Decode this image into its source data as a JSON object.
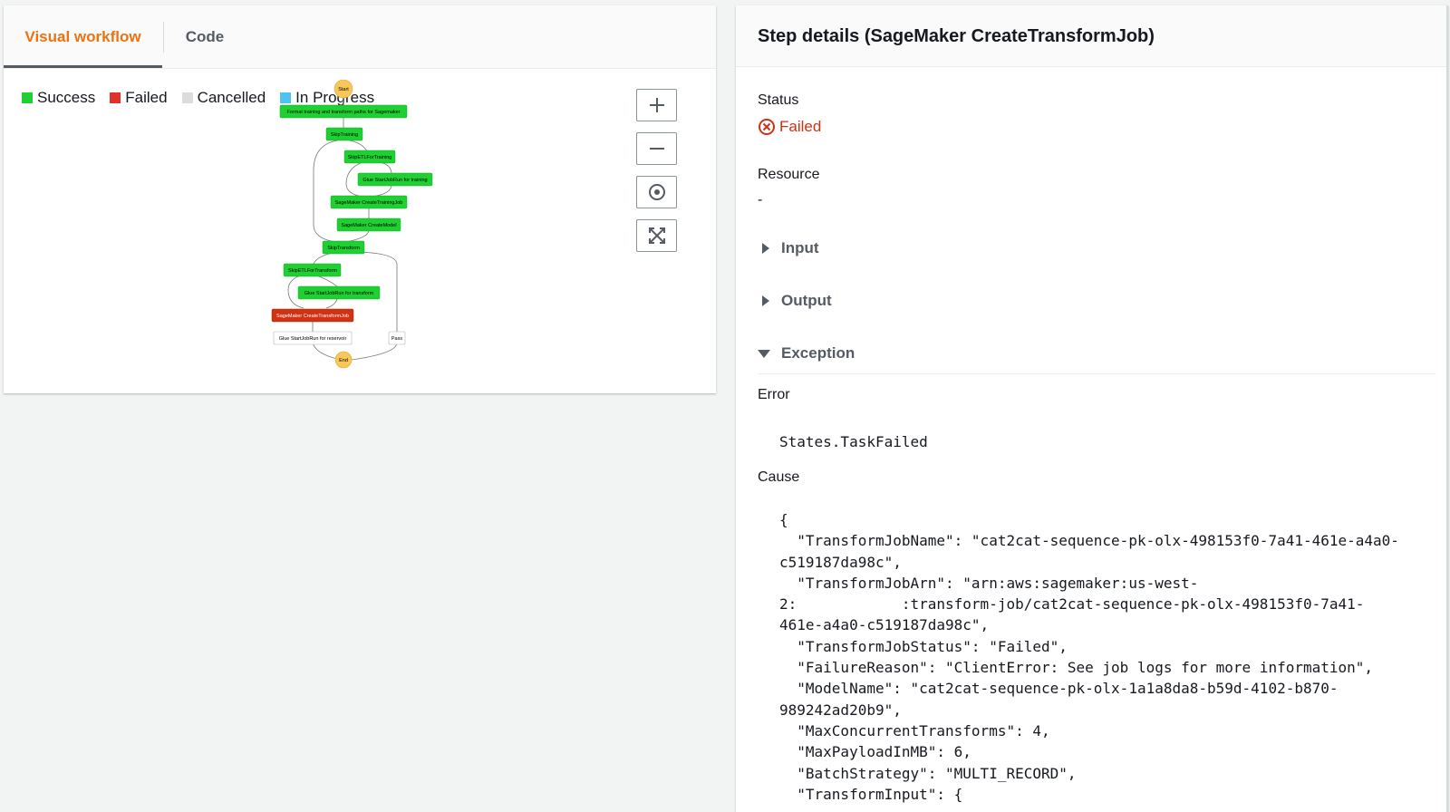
{
  "tabs": [
    {
      "label": "Visual workflow",
      "active": true
    },
    {
      "label": "Code",
      "active": false
    }
  ],
  "legend": [
    {
      "label": "Success",
      "color": "#1ed032"
    },
    {
      "label": "Failed",
      "color": "#e0312b"
    },
    {
      "label": "Cancelled",
      "color": "#dcdcdc"
    },
    {
      "label": "In Progress",
      "color": "#4ec2f0"
    }
  ],
  "zoom_controls": [
    "zoom-in-icon",
    "zoom-out-icon",
    "center-icon",
    "fit-icon"
  ],
  "graph": {
    "start": "Start",
    "end": "End",
    "nodes": [
      {
        "label": "Format training and transform paths for Sagemaker",
        "status": "success"
      },
      {
        "label": "SkipTraining",
        "status": "success"
      },
      {
        "label": "SkipETLForTraining",
        "status": "success"
      },
      {
        "label": "Glue StartJobRun for training",
        "status": "success"
      },
      {
        "label": "SageMaker CreateTrainingJob",
        "status": "success"
      },
      {
        "label": "SageMaker CreateModel",
        "status": "success"
      },
      {
        "label": "SkipTransform",
        "status": "success"
      },
      {
        "label": "SkipETLForTransform",
        "status": "success"
      },
      {
        "label": "Glue StartJobRun for transform",
        "status": "success"
      },
      {
        "label": "SageMaker CreateTransformJob",
        "status": "failed"
      },
      {
        "label": "Glue StartJobRun for reservoir",
        "status": "not-run"
      },
      {
        "label": "Pass",
        "status": "not-run"
      }
    ]
  },
  "details": {
    "title": "Step details (SageMaker CreateTransformJob)",
    "status_label": "Status",
    "status_value": "Failed",
    "resource_label": "Resource",
    "resource_value": "-",
    "input_label": "Input",
    "output_label": "Output",
    "exception_label": "Exception",
    "error_label": "Error",
    "error_value": "States.TaskFailed",
    "cause_label": "Cause",
    "cause_text": "{\n  \"TransformJobName\": \"cat2cat-sequence-pk-olx-498153f0-7a41-461e-a4a0-\nc519187da98c\",\n  \"TransformJobArn\": \"arn:aws:sagemaker:us-west-\n2:            :transform-job/cat2cat-sequence-pk-olx-498153f0-7a41-\n461e-a4a0-c519187da98c\",\n  \"TransformJobStatus\": \"Failed\",\n  \"FailureReason\": \"ClientError: See job logs for more information\",\n  \"ModelName\": \"cat2cat-sequence-pk-olx-1a1a8da8-b59d-4102-b870-\n989242ad20b9\",\n  \"MaxConcurrentTransforms\": 4,\n  \"MaxPayloadInMB\": 6,\n  \"BatchStrategy\": \"MULTI_RECORD\",\n  \"TransformInput\": {"
  }
}
